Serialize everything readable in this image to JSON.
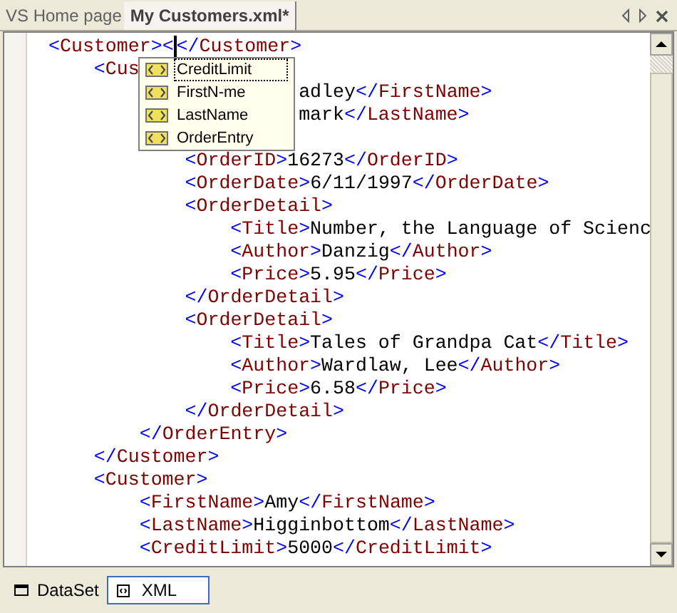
{
  "tabs": [
    {
      "label": "VS Home page",
      "selected": false
    },
    {
      "label": "My Customers.xml*",
      "selected": true
    }
  ],
  "editor": {
    "lines": [
      {
        "text": "<Customer><",
        "caret": true,
        "after_caret": "</Customer>"
      },
      {
        "text": "    <Cus",
        "caret": false
      },
      {
        "text": "                      adley</FirstName>",
        "caret": false
      },
      {
        "text": "                      mark</LastName>",
        "caret": false
      },
      {
        "kind": "hidden"
      },
      {
        "text": "            <OrderID>16273</OrderID>",
        "caret": false
      },
      {
        "text": "            <OrderDate>6/11/1997</OrderDate>",
        "caret": false
      },
      {
        "text": "            <OrderDetail>",
        "caret": false
      },
      {
        "text": "                <Title>Number, the Language of Scienc",
        "caret": false
      },
      {
        "text": "                <Author>Danzig</Author>",
        "caret": false
      },
      {
        "text": "                <Price>5.95</Price>",
        "caret": false
      },
      {
        "text": "            </OrderDetail>",
        "caret": false
      },
      {
        "text": "            <OrderDetail>",
        "caret": false
      },
      {
        "text": "                <Title>Tales of Grandpa Cat</Title>",
        "caret": false
      },
      {
        "text": "                <Author>Wardlaw, Lee</Author>",
        "caret": false
      },
      {
        "text": "                <Price>6.58</Price>",
        "caret": false
      },
      {
        "text": "            </OrderDetail>",
        "caret": false
      },
      {
        "text": "        </OrderEntry>",
        "caret": false
      },
      {
        "text": "    </Customer>",
        "caret": false
      },
      {
        "text": "    <Customer>",
        "caret": false
      },
      {
        "text": "        <FirstName>Amy</FirstName>",
        "caret": false
      },
      {
        "text": "        <LastName>Higginbottom</LastName>",
        "caret": false
      },
      {
        "text": "        <CreditLimit>5000</CreditLimit>",
        "caret": false
      }
    ],
    "completion": [
      {
        "label": "CreditLimit",
        "selected": true
      },
      {
        "label": "FirstN-me",
        "selected": false
      },
      {
        "label": "LastName",
        "selected": false
      },
      {
        "label": "OrderEntry",
        "selected": false
      }
    ]
  },
  "view_tabs": [
    {
      "label": "DataSet",
      "kind": "grid",
      "selected": false
    },
    {
      "label": "XML",
      "kind": "xml",
      "selected": true
    }
  ]
}
